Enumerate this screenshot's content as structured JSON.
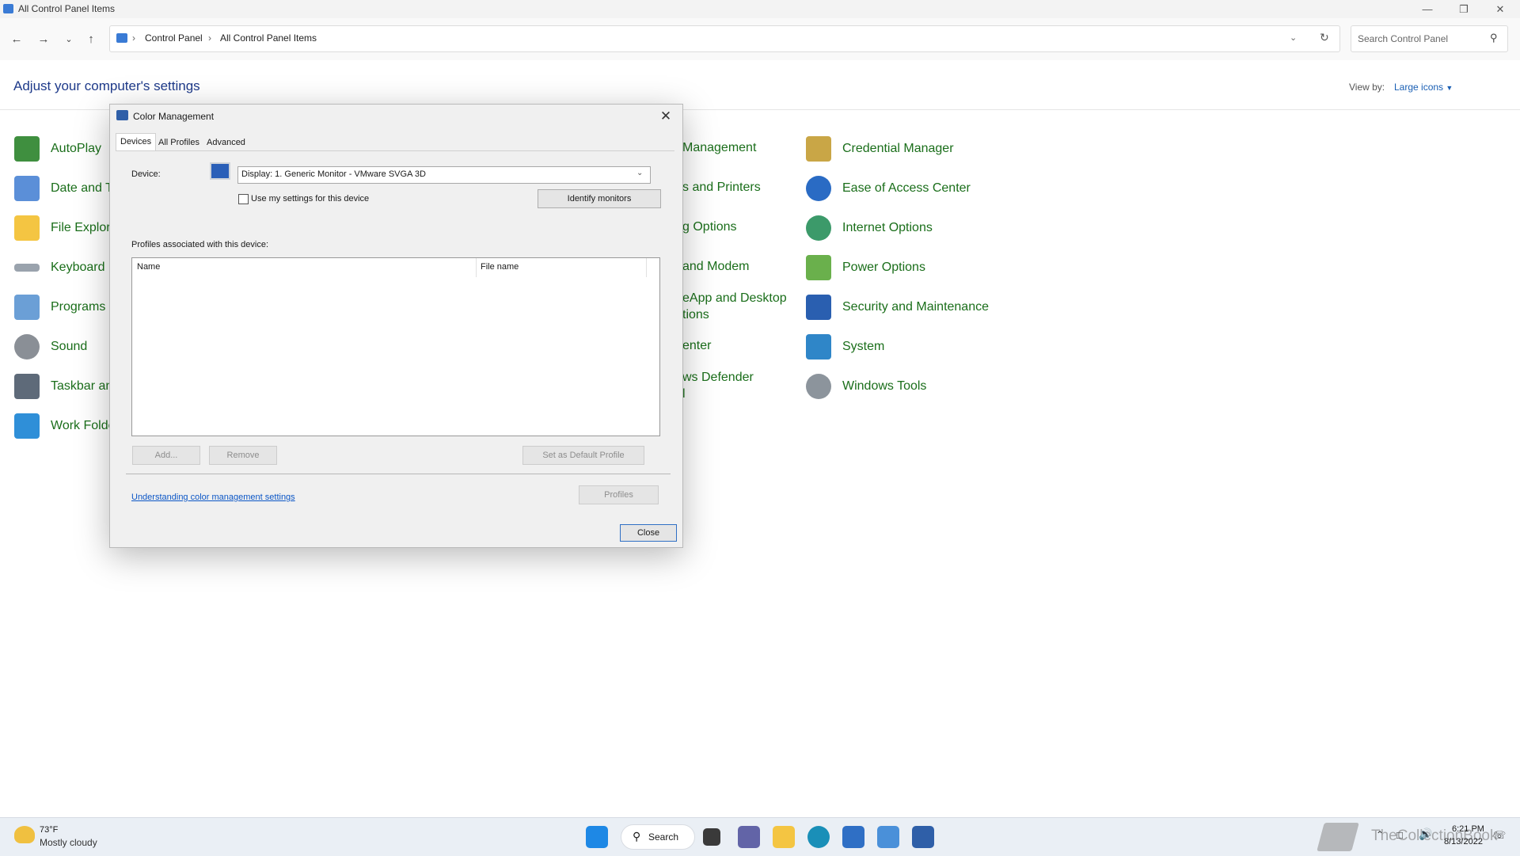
{
  "window": {
    "title": "All Control Panel Items"
  },
  "address_bar": {
    "crumbs": [
      "Control Panel",
      "All Control Panel Items"
    ],
    "search_placeholder": "Search Control Panel"
  },
  "header": {
    "title": "Adjust your computer's settings",
    "view_by_label": "View by:",
    "view_by_value": "Large icons"
  },
  "control_panel": {
    "column1": [
      "AutoPlay",
      "Date and Ti",
      "File Explore",
      "Keyboard",
      "Programs a",
      "Sound",
      "Taskbar and",
      "Work Folde"
    ],
    "column2": [
      "Management",
      "s and Printers",
      "g Options",
      "and Modem",
      "eApp and Desktop",
      "tions",
      "enter",
      "ws Defender",
      "l"
    ],
    "column3": [
      "Credential Manager",
      "Ease of Access Center",
      "Internet Options",
      "Power Options",
      "Security and Maintenance",
      "System",
      "Windows Tools"
    ]
  },
  "dialog": {
    "title": "Color Management",
    "tabs": [
      "Devices",
      "All Profiles",
      "Advanced"
    ],
    "device_label": "Device:",
    "device_value": "Display: 1. Generic Monitor - VMware SVGA 3D",
    "use_my_settings": "Use my settings for this device",
    "identify_monitors": "Identify monitors",
    "profiles_label": "Profiles associated with this device:",
    "columns": [
      "Name",
      "File name"
    ],
    "add_button": "Add...",
    "remove_button": "Remove",
    "set_default_button": "Set as Default Profile",
    "help_link": "Understanding color management settings",
    "profiles_button": "Profiles",
    "close_button": "Close"
  },
  "taskbar": {
    "weather_temp": "73°F",
    "weather_desc": "Mostly cloudy",
    "search_label": "Search",
    "time": "6:21 PM",
    "date": "8/13/2022",
    "watermark": "TheCollectionBook"
  },
  "colors": {
    "link_green": "#1a6e1a",
    "accent_blue": "#0b56c6",
    "taskbar": "#eaeff5"
  }
}
